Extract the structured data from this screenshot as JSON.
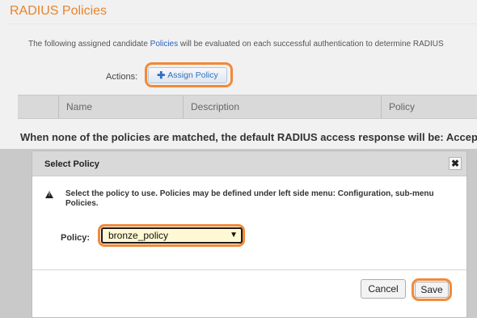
{
  "page": {
    "title": "RADIUS Policies",
    "description_prefix": "The following assigned candidate ",
    "description_link": "Policies",
    "description_suffix": " will be evaluated on each successful authentication to determine RADIUS",
    "actions_label": "Actions:",
    "assign_button_label": "Assign Policy",
    "table_headers": [
      "",
      "Name",
      "Description",
      "Policy"
    ],
    "default_message": "When none of the policies are matched, the default RADIUS access response will be: Accept"
  },
  "dialog": {
    "title": "Select Policy",
    "close_symbol": "✖",
    "message": "Select the policy to use. Policies may be defined under left side menu: Configuration, sub-menu Policies.",
    "policy_label": "Policy:",
    "policy_selected": "bronze_policy",
    "cancel_label": "Cancel",
    "save_label": "Save"
  },
  "colors": {
    "title": "#e8842c",
    "highlight": "#f08a3a",
    "link": "#2a62b8"
  },
  "icons": {
    "assign": "plus-icon",
    "warning": "warning-icon",
    "close": "close-icon",
    "dropdown": "chevron-down-icon"
  }
}
